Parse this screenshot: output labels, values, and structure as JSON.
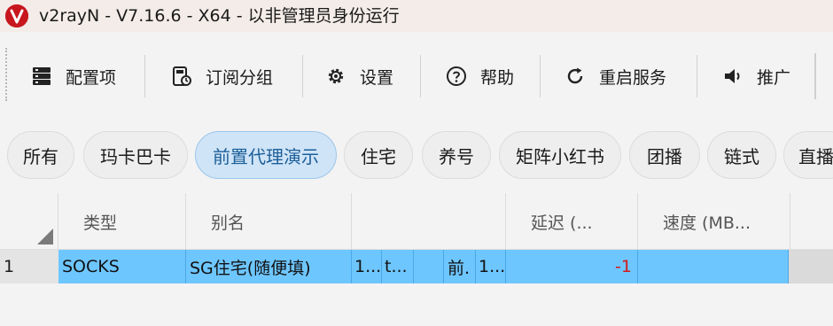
{
  "window": {
    "title": "v2rayN - V7.16.6 - X64 - 以非管理员身份运行",
    "brand_color": "#c8161e"
  },
  "toolbar": {
    "items": [
      {
        "label": "配置项",
        "icon": "server-icon"
      },
      {
        "label": "订阅分组",
        "icon": "subscription-icon"
      },
      {
        "label": "设置",
        "icon": "gear-icon"
      },
      {
        "label": "帮助",
        "icon": "help-icon"
      },
      {
        "label": "重启服务",
        "icon": "restart-icon"
      },
      {
        "label": "推广",
        "icon": "megaphone-icon"
      }
    ]
  },
  "tabs": {
    "items": [
      "所有",
      "玛卡巴卡",
      "前置代理演示",
      "住宅",
      "养号",
      "矩阵小红书",
      "团播",
      "链式",
      "直播"
    ],
    "active_index": 2,
    "active_color": "#cfe4f7"
  },
  "grid": {
    "columns": [
      "类型",
      "别名",
      "",
      "延迟 (...",
      "速度 (MB..."
    ],
    "rows": [
      {
        "index": "1",
        "type": "SOCKS",
        "alias": "SG住宅(随便填)",
        "c1": "1...",
        "c2": "t...",
        "c3": "",
        "c4": "前.",
        "c5": "1...",
        "delay": "-1",
        "speed": ""
      }
    ],
    "selection_color": "#6ec6ff",
    "delay_color": "#d11a1a"
  }
}
